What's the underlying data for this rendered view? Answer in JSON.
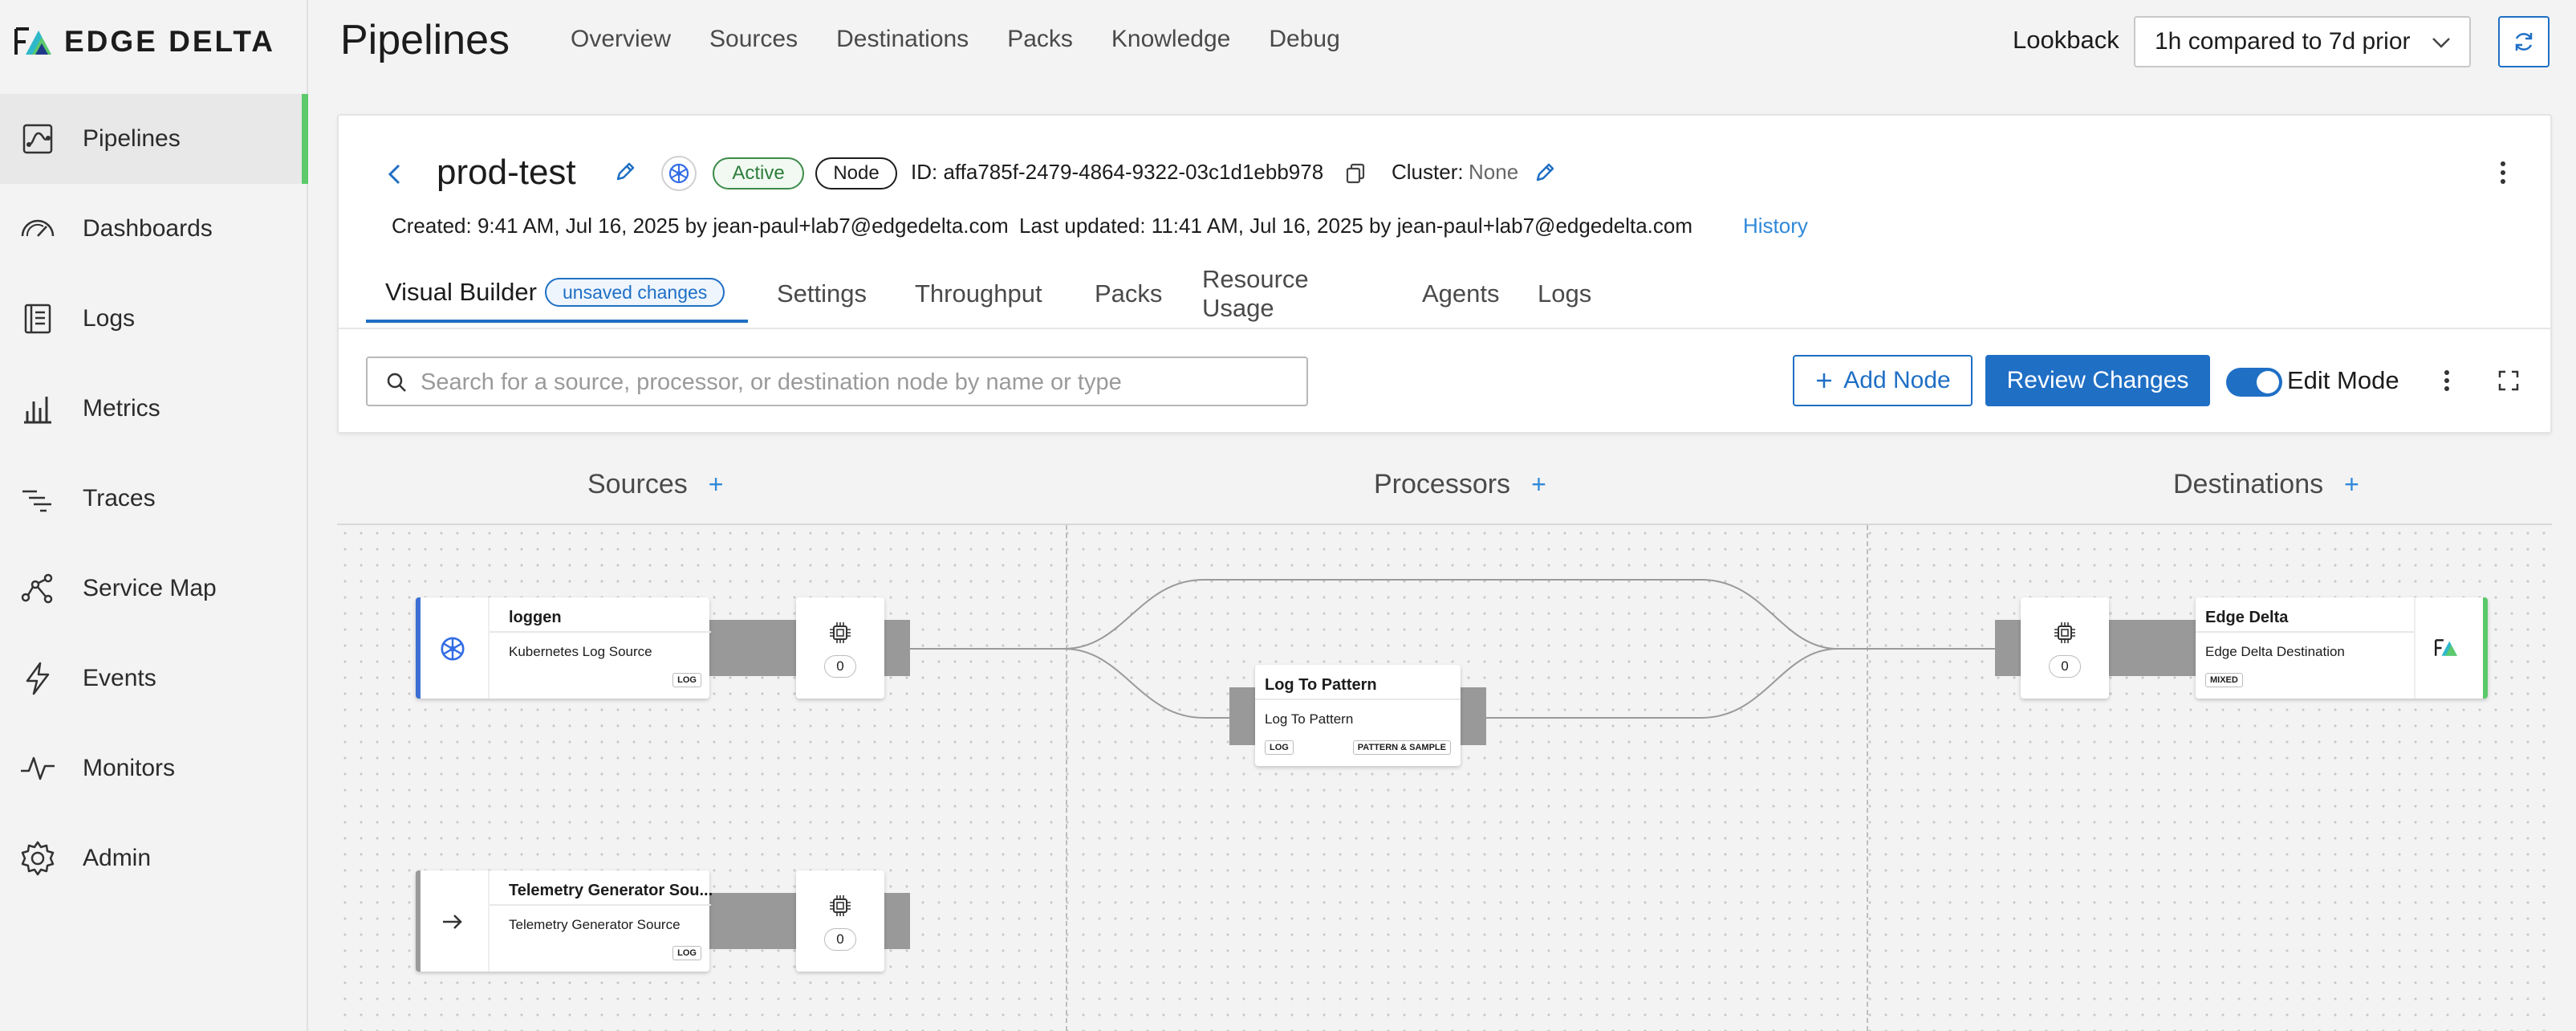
{
  "logo": {
    "text": "EDGE DELTA"
  },
  "sidebar": {
    "items": [
      {
        "label": "Pipelines"
      },
      {
        "label": "Dashboards"
      },
      {
        "label": "Logs"
      },
      {
        "label": "Metrics"
      },
      {
        "label": "Traces"
      },
      {
        "label": "Service Map"
      },
      {
        "label": "Events"
      },
      {
        "label": "Monitors"
      },
      {
        "label": "Admin"
      }
    ]
  },
  "header": {
    "title": "Pipelines",
    "nav": [
      "Overview",
      "Sources",
      "Destinations",
      "Packs",
      "Knowledge",
      "Debug"
    ],
    "lookback_label": "Lookback",
    "lookback_value": "1h compared to 7d prior"
  },
  "pipeline": {
    "name": "prod-test",
    "status": "Active",
    "type": "Node",
    "id": "ID: affa785f-2479-4864-9322-03c1d1ebb978",
    "cluster_label": "Cluster:",
    "cluster_value": "None",
    "created": "Created: 9:41 AM, Jul 16, 2025 by jean-paul+lab7@edgedelta.com",
    "updated": "Last updated: 11:41 AM, Jul 16, 2025 by jean-paul+lab7@edgedelta.com",
    "history": "History"
  },
  "tabs": {
    "visual_builder": "Visual Builder",
    "unsaved": "unsaved changes",
    "items": [
      "Settings",
      "Throughput",
      "Packs",
      "Resource Usage",
      "Agents",
      "Logs"
    ]
  },
  "toolbar": {
    "search_placeholder": "Search for a source, processor, or destination node by name or type",
    "add_node": "Add Node",
    "review_changes": "Review Changes",
    "edit_mode": "Edit Mode"
  },
  "canvas": {
    "columns": [
      "Sources",
      "Processors",
      "Destinations"
    ],
    "sources": [
      {
        "title": "loggen",
        "subtitle": "Kubernetes Log Source",
        "tag": "LOG",
        "count": "0"
      },
      {
        "title": "Telemetry Generator Sou...",
        "subtitle": "Telemetry Generator Source",
        "tag": "LOG",
        "count": "0"
      }
    ],
    "processor": {
      "title": "Log To Pattern",
      "subtitle": "Log To Pattern",
      "tag_in": "LOG",
      "tag_out": "PATTERN & SAMPLE"
    },
    "destination": {
      "title": "Edge Delta",
      "subtitle": "Edge Delta Destination",
      "tag": "MIXED",
      "count": "0"
    }
  },
  "colors": {
    "accent": "#1f6fc5",
    "active_green": "#5cc96b",
    "link": "#2f88d9"
  }
}
